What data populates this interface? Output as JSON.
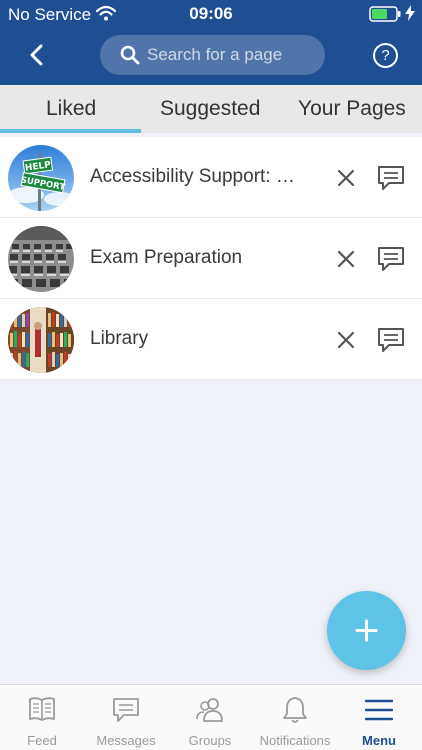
{
  "status_bar": {
    "carrier": "No Service",
    "time": "09:06"
  },
  "header": {
    "search_placeholder": "Search for a page",
    "help_label": "?"
  },
  "tabs": [
    {
      "label": "Liked",
      "selected": true
    },
    {
      "label": "Suggested",
      "selected": false
    },
    {
      "label": "Your Pages",
      "selected": false
    }
  ],
  "pages": [
    {
      "name": "Accessibility Support: Help & Advice",
      "avatar": "help-support-sign"
    },
    {
      "name": "Exam Preparation",
      "avatar": "exam-hall"
    },
    {
      "name": "Library",
      "avatar": "library-shelves"
    }
  ],
  "bottom_nav": [
    {
      "label": "Feed",
      "icon": "book-icon",
      "active": false
    },
    {
      "label": "Messages",
      "icon": "message-icon",
      "active": false
    },
    {
      "label": "Groups",
      "icon": "groups-icon",
      "active": false
    },
    {
      "label": "Notifications",
      "icon": "bell-icon",
      "active": false
    },
    {
      "label": "Menu",
      "icon": "menu-icon",
      "active": true
    }
  ],
  "colors": {
    "header": "#1f4f93",
    "accent": "#5ec3e6",
    "tab_indicator": "#5fbfe0"
  }
}
